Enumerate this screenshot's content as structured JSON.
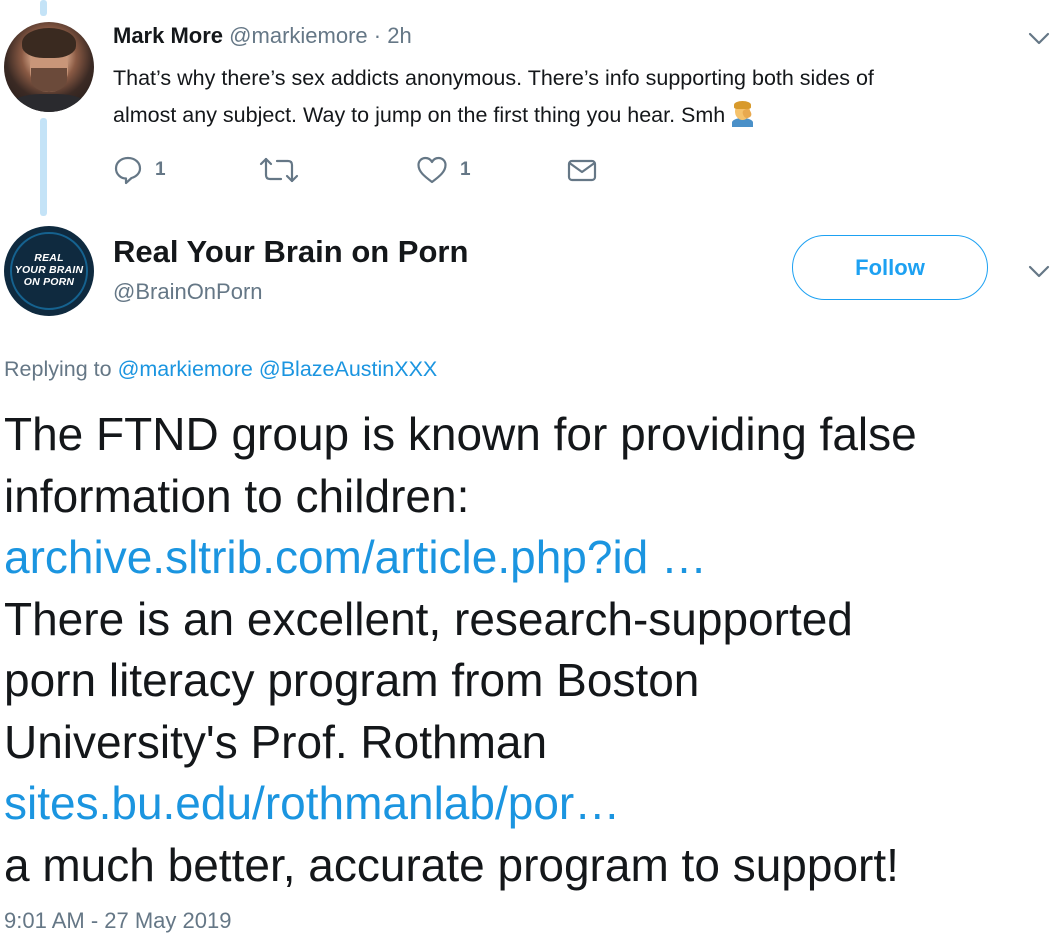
{
  "parent_tweet": {
    "author_name": "Mark More",
    "author_handle": "@markiemore",
    "separator": "·",
    "time_ago": "2h",
    "text_line1": "That’s why there’s sex addicts anonymous. There’s info supporting both sides of",
    "text_line2": "almost any subject. Way to jump on the first thing you hear. Smh",
    "emoji": "man-facepalming-icon",
    "actions": {
      "reply_count": "1",
      "retweet_count": "",
      "like_count": "1"
    }
  },
  "main_tweet": {
    "author_name": "Real Your Brain on Porn",
    "author_handle": "@BrainOnPorn",
    "avatar_text": [
      "REAL",
      "YOUR BRAIN",
      "ON PORN"
    ],
    "follow_label": "Follow",
    "replying_prefix": "Replying to",
    "reply_mentions": [
      "@markiemore",
      "@BlazeAustinXXX"
    ],
    "body": {
      "line1": "The FTND group is known for providing false",
      "line2": "information to children:",
      "link1": "archive.sltrib.com/article.php?id …",
      "line3": "There is an excellent, research-supported",
      "line4": "porn literacy program from Boston",
      "line5": "University's Prof. Rothman",
      "link2": "sites.bu.edu/rothmanlab/por…",
      "line6": "a much better, accurate program to support!"
    },
    "timestamp": "9:01 AM - 27 May 2019"
  },
  "colors": {
    "link": "#1b95e0",
    "follow_accent": "#1da1f2",
    "secondary_text": "#657786",
    "thread_line": "#c4e3f7"
  }
}
